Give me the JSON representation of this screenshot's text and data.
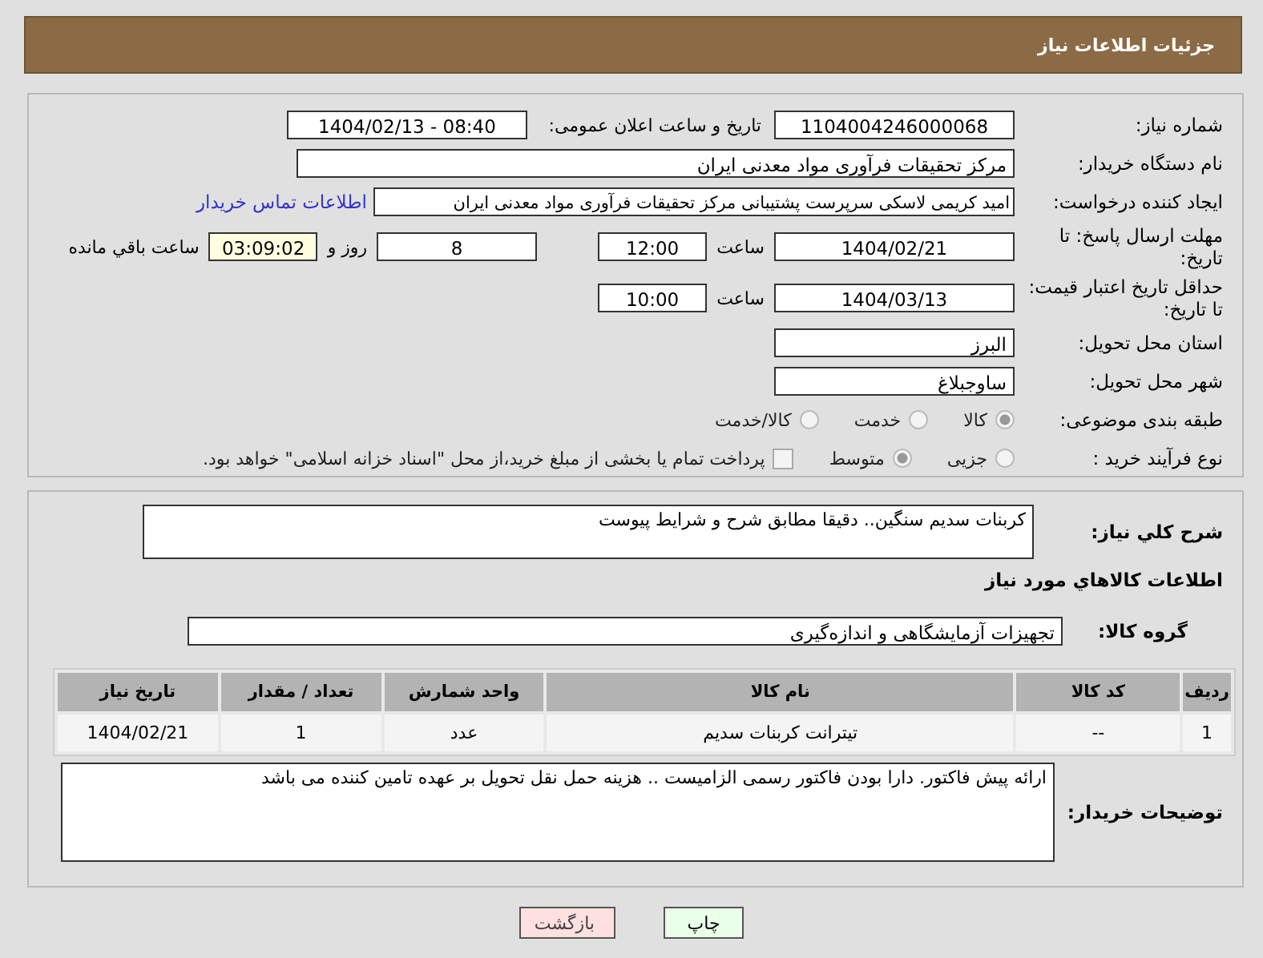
{
  "header": {
    "title": "جزئیات اطلاعات نیاز"
  },
  "need_number": {
    "label": "شماره نیاز:",
    "value": "1104004246000068"
  },
  "announce": {
    "label": "تاریخ و ساعت اعلان عمومی:",
    "value": "1404/02/13 - 08:40"
  },
  "buyer": {
    "label": "نام دستگاه خریدار:",
    "value": "مرکز تحقیقات فرآوری مواد معدنی ایران"
  },
  "requester": {
    "label": "ایجاد کننده درخواست:",
    "value": "امید کریمی لاسکی سرپرست پشتیبانی مرکز تحقیقات فرآوری مواد معدنی ایران",
    "link": "اطلاعات تماس خریدار"
  },
  "deadline": {
    "label": "مهلت ارسال پاسخ: تا تاریخ:",
    "date": "1404/02/21",
    "time_label": "ساعت",
    "time": "12:00",
    "days": "8",
    "days_label": "روز و",
    "remaining": "03:09:02",
    "remaining_label": "ساعت باقي مانده"
  },
  "validity": {
    "label": "حداقل تاریخ اعتبار قیمت: تا تاریخ:",
    "date": "1404/03/13",
    "time_label": "ساعت",
    "time": "10:00"
  },
  "province": {
    "label": "استان محل تحویل:",
    "value": "البرز"
  },
  "city": {
    "label": "شهر محل تحویل:",
    "value": "ساوجبلاغ"
  },
  "category": {
    "label": "طبقه بندی موضوعی:",
    "options": [
      {
        "label": "کالا",
        "selected": true
      },
      {
        "label": "خدمت",
        "selected": false
      },
      {
        "label": "کالا/خدمت",
        "selected": false
      }
    ]
  },
  "process": {
    "label": "نوع فرآیند خرید :",
    "options": [
      {
        "label": "جزیی",
        "selected": false
      },
      {
        "label": "متوسط",
        "selected": true
      }
    ],
    "payment": {
      "checked": false,
      "text": "پرداخت تمام یا بخشی از مبلغ خرید،از محل \"اسناد خزانه اسلامی\" خواهد بود."
    }
  },
  "description": {
    "label": "شرح کلي نياز:",
    "value": "کربنات سدیم سنگین.. دقیقا مطابق شرح و شرایط پیوست"
  },
  "goods_heading": "اطلاعات کالاهاي مورد نياز",
  "goods_group": {
    "label": "گروه کالا:",
    "value": "تجهیزات آزمایشگاهی و اندازه‌گیری"
  },
  "table": {
    "columns": [
      "ردیف",
      "کد کالا",
      "نام کالا",
      "واحد شمارش",
      "تعداد / مقدار",
      "تاریخ نیاز"
    ],
    "rows": [
      [
        "1",
        "--",
        "تیترانت کربنات سدیم",
        "عدد",
        "1",
        "1404/02/21"
      ]
    ]
  },
  "buyer_notes": {
    "label": "توضیحات خریدار:",
    "value": "ارائه پیش فاکتور. دارا بودن فاکتور رسمی الزامیست .. هزینه حمل نقل تحویل بر عهده تامین کننده می باشد"
  },
  "buttons": [
    {
      "kind": "print",
      "label": "چاپ"
    },
    {
      "kind": "back",
      "label": "بازگشت"
    }
  ]
}
